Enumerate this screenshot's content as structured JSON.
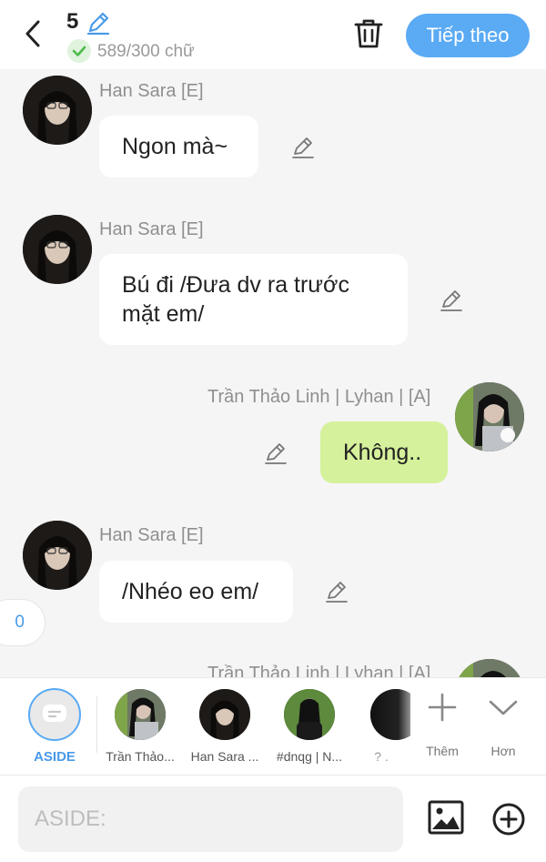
{
  "header": {
    "back_icon": "chevron-left-icon",
    "title_number": "5",
    "edit_icon": "pencil-icon",
    "check_icon": "check-icon",
    "word_count": "589/300 chữ",
    "trash_icon": "trash-icon",
    "next_label": "Tiếp theo"
  },
  "colors": {
    "accent": "#5aaaf4",
    "my_bubble": "#d5f19b",
    "other_bubble": "#ffffff",
    "background": "#f5f5f5",
    "check_green": "#4cbb4a"
  },
  "messages": [
    {
      "sender": "Han Sara [E]",
      "text": "Ngon mà~",
      "side": "left"
    },
    {
      "sender": "Han Sara [E]",
      "text": "Bú đi /Đưa dv ra trước mặt em/",
      "side": "left"
    },
    {
      "sender": "Trần Thảo Linh | Lyhan | [A]",
      "text": "Không..",
      "side": "right"
    },
    {
      "sender": "Han Sara [E]",
      "text": "/Nhéo eo em/",
      "side": "left"
    },
    {
      "sender": "Trần Thảo Linh | Lyhan | [A]",
      "text": "",
      "side": "right"
    }
  ],
  "floating_badge": "0",
  "character_bar": {
    "aside_label": "ASIDE",
    "characters": [
      {
        "name": "Trần Thảo..."
      },
      {
        "name": "Han Sara ..."
      },
      {
        "name": "#dnqg | N..."
      },
      {
        "name": "? ."
      }
    ],
    "add_label": "Thêm",
    "more_label": "Hơn"
  },
  "input": {
    "placeholder": "ASIDE:",
    "value": "",
    "image_icon": "image-icon",
    "add_icon": "plus-circle-icon"
  }
}
